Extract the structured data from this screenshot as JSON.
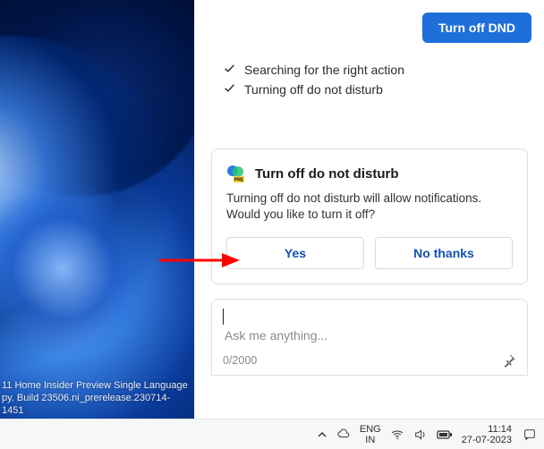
{
  "desktop": {
    "watermark_line1": "11 Home Insider Preview Single Language",
    "watermark_line2": "py. Build 23506.ni_prerelease.230714-1451"
  },
  "panel": {
    "primary_button": "Turn off DND",
    "steps": [
      "Searching for the right action",
      "Turning off do not disturb"
    ]
  },
  "card": {
    "title": "Turn off do not disturb",
    "body": "Turning off do not disturb will allow notifications. Would you like to turn it off?",
    "yes": "Yes",
    "no": "No thanks"
  },
  "composer": {
    "placeholder": "Ask me anything...",
    "value": "",
    "counter": "0/2000"
  },
  "taskbar": {
    "lang_top": "ENG",
    "lang_bottom": "IN",
    "time": "11:14",
    "date": "27-07-2023"
  }
}
